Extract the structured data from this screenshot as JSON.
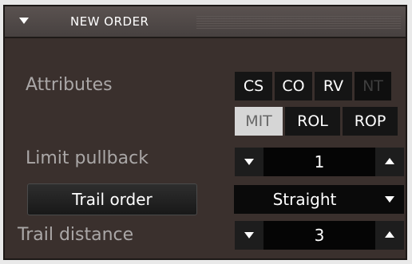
{
  "panel": {
    "title": "NEW ORDER",
    "collapse_icon": "triangle-down-icon"
  },
  "attributes": {
    "label": "Attributes",
    "tags_row1": [
      {
        "label": "CS",
        "state": "normal"
      },
      {
        "label": "CO",
        "state": "normal"
      },
      {
        "label": "RV",
        "state": "normal"
      },
      {
        "label": "NT",
        "state": "disabled"
      }
    ],
    "tags_row2": [
      {
        "label": "MIT",
        "state": "active"
      },
      {
        "label": "ROL",
        "state": "normal"
      },
      {
        "label": "ROP",
        "state": "normal"
      }
    ]
  },
  "limit_pullback": {
    "label": "Limit pullback",
    "value": "1",
    "decrement_icon": "triangle-down-icon",
    "increment_icon": "triangle-up-icon"
  },
  "trail_order": {
    "button_label": "Trail order",
    "selected": "Straight",
    "dropdown_icon": "triangle-down-icon"
  },
  "trail_distance": {
    "label": "Trail distance",
    "value": "3",
    "decrement_icon": "triangle-down-icon",
    "increment_icon": "triangle-up-icon"
  },
  "colors": {
    "panel_bg": "#3a302d",
    "header_bg": "#4a4442",
    "label_text": "#aaa7a7",
    "active_tag_bg": "#d6d6d6",
    "disabled_tag_text": "#3e3e3e"
  }
}
